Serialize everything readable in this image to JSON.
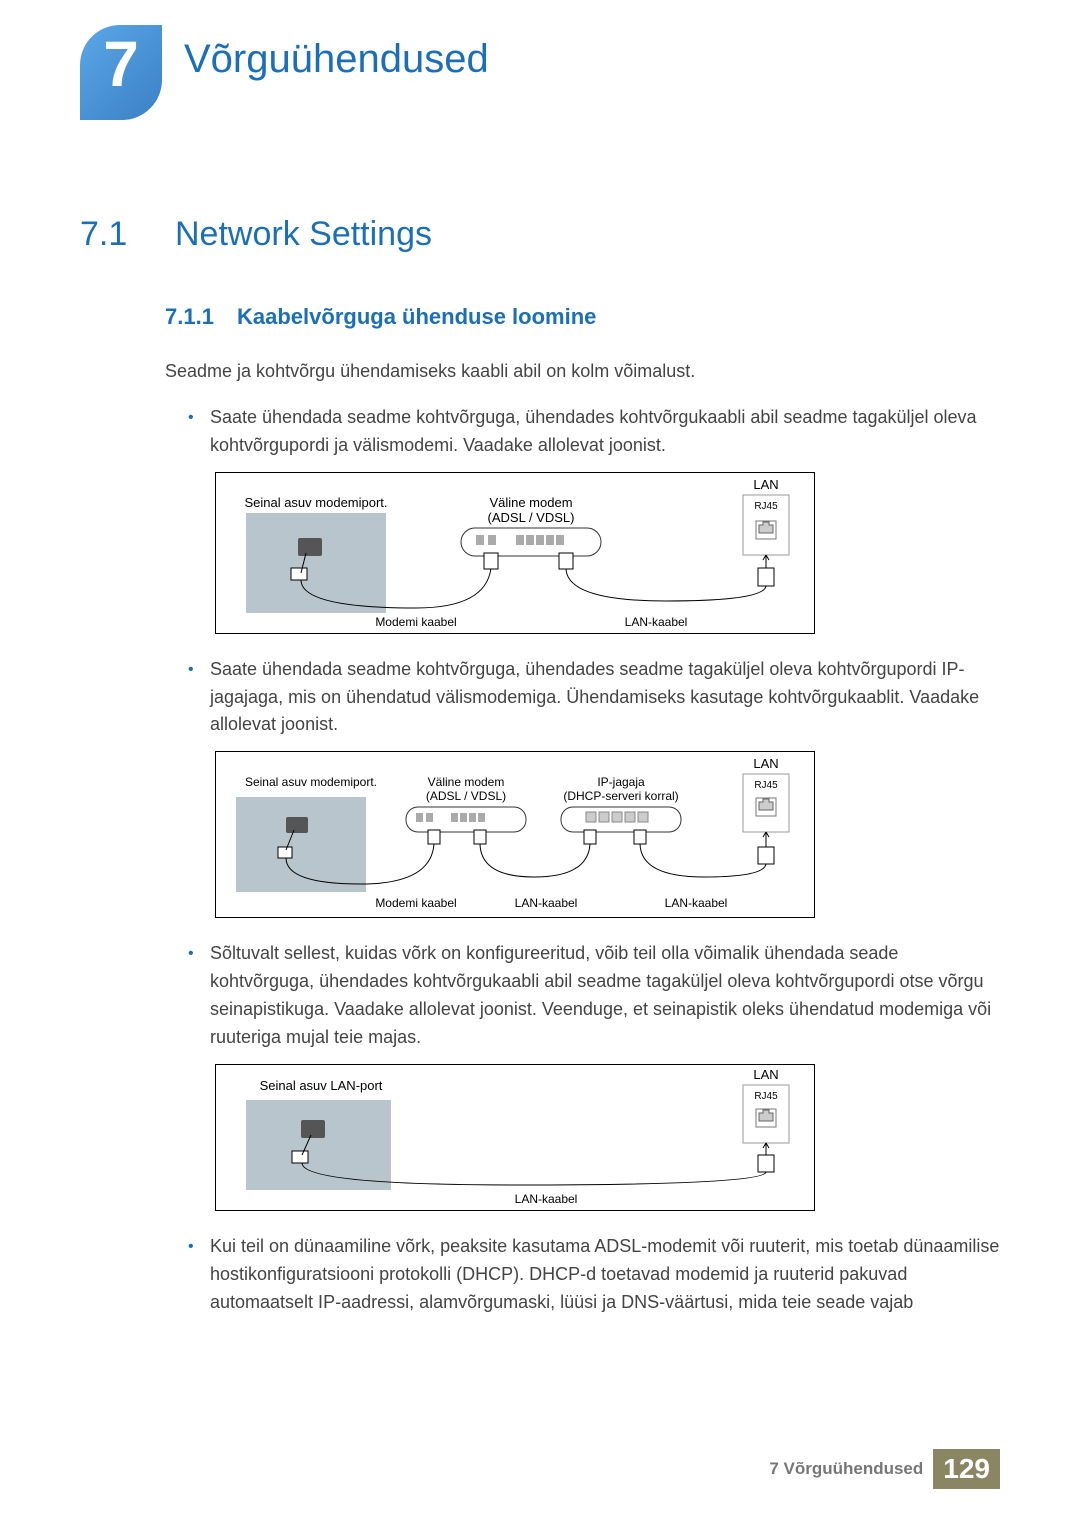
{
  "chapter_number": "7",
  "chapter_title": "Võrguühendused",
  "section": {
    "number": "7.1",
    "title": "Network Settings"
  },
  "subsection": {
    "number": "7.1.1",
    "title": "Kaabelvõrguga ühenduse loomine"
  },
  "intro_para": "Seadme ja kohtvõrgu ühendamiseks kaabli abil on kolm võimalust.",
  "bullet1": "Saate ühendada seadme kohtvõrguga, ühendades kohtvõrgukaabli abil seadme tagaküljel oleva kohtvõrgupordi ja välismodemi. Vaadake allolevat joonist.",
  "bullet2": "Saate ühendada seadme kohtvõrguga, ühendades seadme tagaküljel oleva kohtvõrgupordi IP-jagajaga, mis on ühendatud välismodemiga. Ühendamiseks kasutage kohtvõrgukaablit. Vaadake allolevat joonist.",
  "bullet3": "Sõltuvalt sellest, kuidas võrk on konfigureeritud, võib teil olla võimalik ühendada seade kohtvõrguga, ühendades kohtvõrgukaabli abil seadme tagaküljel oleva kohtvõrgupordi otse võrgu seinapistikuga. Vaadake allolevat joonist. Veenduge, et seinapistik oleks ühendatud modemiga või ruuteriga mujal teie majas.",
  "bullet4": "Kui teil on dünaamiline võrk, peaksite kasutama ADSL-modemit või ruuterit, mis toetab dünaamilise hostikonfiguratsiooni protokolli (DHCP). DHCP-d toetavad modemid ja ruuterid pakuvad automaatselt IP-aadressi, alamvõrgumaski, lüüsi ja DNS-väärtusi, mida teie seade vajab",
  "diagram1": {
    "wall_port": "Seinal asuv modemiport.",
    "modem_title": "Väline modem",
    "modem_sub": "(ADSL / VDSL)",
    "lan": "LAN",
    "rj45": "RJ45",
    "modem_cable": "Modemi kaabel",
    "lan_cable": "LAN-kaabel"
  },
  "diagram2": {
    "wall_port": "Seinal asuv modemiport.",
    "modem_title": "Väline modem",
    "modem_sub": "(ADSL / VDSL)",
    "ip_title": "IP-jagaja",
    "ip_sub": "(DHCP-serveri korral)",
    "lan": "LAN",
    "rj45": "RJ45",
    "modem_cable": "Modemi kaabel",
    "lan_cable1": "LAN-kaabel",
    "lan_cable2": "LAN-kaabel"
  },
  "diagram3": {
    "wall_port": "Seinal asuv LAN-port",
    "lan": "LAN",
    "rj45": "RJ45",
    "lan_cable": "LAN-kaabel"
  },
  "footer": {
    "text": "7 Võrguühendused",
    "page": "129"
  }
}
